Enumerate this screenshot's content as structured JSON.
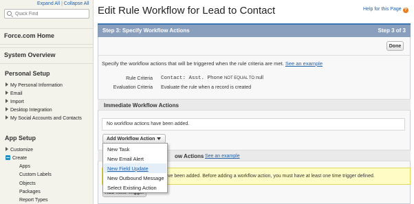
{
  "sidebar": {
    "expand_all": "Expand All",
    "separator": "|",
    "collapse_all": "Collapse All",
    "search_placeholder": "Quick Find",
    "nav": [
      "Force.com Home",
      "System Overview"
    ],
    "personal_setup": {
      "title": "Personal Setup",
      "items": [
        "My Personal Information",
        "Email",
        "Import",
        "Desktop Integration",
        "My Social Accounts and Contacts"
      ]
    },
    "app_setup": {
      "title": "App Setup",
      "items": [
        "Customize",
        "Create"
      ],
      "create_sub": [
        "Apps",
        "Custom Labels",
        "Objects",
        "Packages",
        "Report Types"
      ]
    }
  },
  "main": {
    "title": "Edit Rule Workflow for Lead to Contact",
    "help_link": "Help for this Page",
    "help_icon": "?",
    "step_title": "Step 3: Specify Workflow Actions",
    "step_count": "Step 3 of 3",
    "done_label": "Done",
    "description": "Specify the workflow actions that will be triggered when the rule criteria are met.",
    "see_example": "See an example",
    "rule_criteria_label": "Rule Criteria",
    "rule_criteria_field": "Contact: Asst. Phone",
    "rule_criteria_op": "NOT EQUAL TO",
    "rule_criteria_value": "null",
    "evaluation_label": "Evaluation Criteria",
    "evaluation_value": "Evaluate the rule when a record is created",
    "immediate_title": "Immediate Workflow Actions",
    "no_actions": "No workflow actions have been added.",
    "add_action_label": "Add Workflow Action",
    "time_section_title_tail": "ow Actions",
    "time_section_link": "See an example",
    "warning_text": "ve been added. Before adding a workflow action, you must have at least one time trigger defined.",
    "add_time_trigger_label": "Add Time Trigger"
  },
  "dropdown": {
    "items": [
      "New Task",
      "New Email Alert",
      "New Field Update",
      "New Outbound Message",
      "Select Existing Action"
    ],
    "active_index": 2
  },
  "colors": {
    "step_header": "#8a9ebe",
    "link": "#1f5fa8",
    "warning_bg": "#fffdc5"
  }
}
